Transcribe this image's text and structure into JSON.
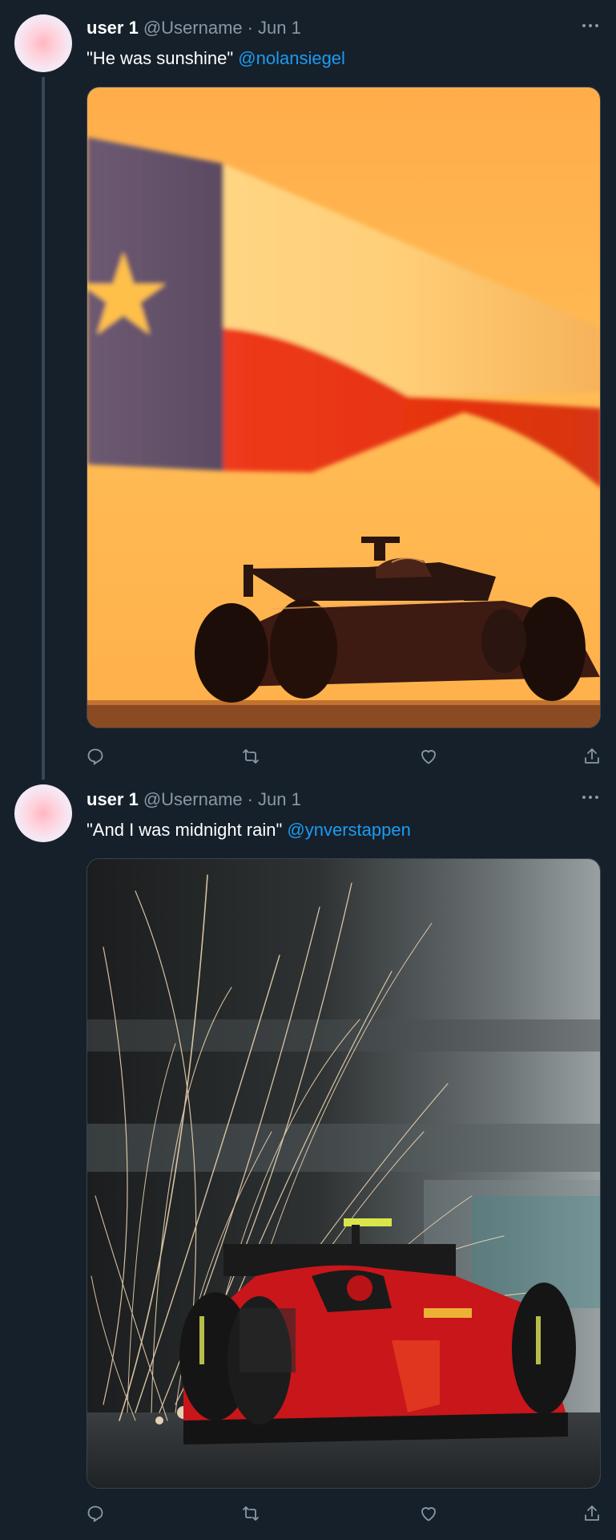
{
  "tweets": [
    {
      "name": "user 1",
      "handle": "@Username",
      "separator": "·",
      "date": "Jun 1",
      "text": "\"He was sunshine\" ",
      "mention": "@nolansiegel",
      "media_description": "sunset"
    },
    {
      "name": "user 1",
      "handle": "@Username",
      "separator": "·",
      "date": "Jun 1",
      "text": "\"And I was midnight rain\" ",
      "mention": "@ynverstappen",
      "media_description": "sparks"
    }
  ],
  "icons": [
    "reply-icon",
    "retweet-icon",
    "like-icon",
    "share-icon",
    "more-icon"
  ],
  "colors": {
    "background": "#15202b",
    "mention": "#1d9bf0",
    "muted": "#8b98a5",
    "border": "#38444d"
  }
}
